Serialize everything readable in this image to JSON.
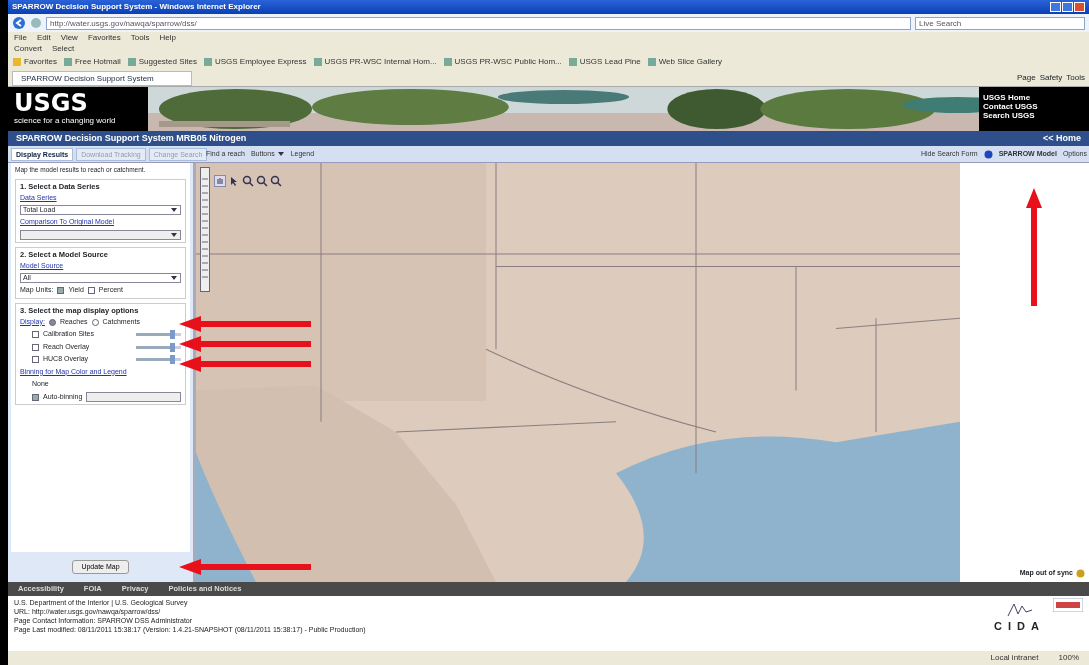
{
  "browser": {
    "title": "SPARROW Decision Support System - Windows Internet Explorer",
    "address": "http://water.usgs.gov/nawqa/sparrow/dss/",
    "search": "Live Search",
    "menu": [
      "File",
      "Edit",
      "View",
      "Favorites",
      "Tools",
      "Help"
    ],
    "toolbar": [
      "Convert",
      "Select"
    ],
    "favorites": [
      "Favorites",
      "Free Hotmail",
      "Suggested Sites",
      "USGS Employee Express",
      "USGS PR-WSC Internal Hom...",
      "USGS PR-WSC Public Hom...",
      "USGS Lead Pine",
      "Web Slice Gallery"
    ],
    "tab": "SPARROW Decision Support System",
    "commands": [
      "Page",
      "Safety",
      "Tools"
    ]
  },
  "banner": {
    "logo": "USGS",
    "tagline": "science for a changing world",
    "links": [
      "USGS Home",
      "Contact USGS",
      "Search USGS"
    ]
  },
  "app_title": "SPARROW Decision Support System MRB05 Nitrogen",
  "home_link": "<< Home",
  "tabs": [
    {
      "label": "Display Results",
      "selected": true
    },
    {
      "label": "Download Tracking",
      "selected": false
    },
    {
      "label": "Change Search",
      "selected": false
    }
  ],
  "map_toolbar": {
    "find": "Find a reach",
    "buttons": "Buttons",
    "legend": "Legend",
    "hide": "Hide Search Form",
    "model": "SPARROW Model",
    "options": "Options"
  },
  "hint": "Map the model results to reach or catchment.",
  "sections": [
    {
      "title": "1. Select a Data Series",
      "rows": [
        {
          "kind": "link",
          "text": "Data Series"
        },
        {
          "kind": "select",
          "text": "Total Load",
          "disabled": false
        },
        {
          "kind": "link",
          "text": "Comparison To Original Model"
        },
        {
          "kind": "select",
          "text": "",
          "disabled": true
        }
      ]
    },
    {
      "title": "2. Select a Model Source",
      "rows": [
        {
          "kind": "link",
          "text": "Model Source"
        },
        {
          "kind": "select",
          "text": "All",
          "disabled": false
        },
        {
          "kind": "units",
          "text": "Map Units:",
          "options": [
            {
              "label": "Yield",
              "checked": true
            },
            {
              "label": "Percent",
              "checked": false
            }
          ]
        }
      ]
    },
    {
      "title": "3. Select the map display options",
      "rows": [
        {
          "kind": "display",
          "text": "Display:",
          "options": [
            {
              "label": "Reaches",
              "selected": true
            },
            {
              "label": "Catchments",
              "selected": false
            }
          ]
        },
        {
          "kind": "overlay",
          "text": "Calibration Sites",
          "checked": false,
          "level": 0.8
        },
        {
          "kind": "overlay",
          "text": "Reach Overlay",
          "checked": false,
          "level": 0.8
        },
        {
          "kind": "overlay",
          "text": "HUC8 Overlay",
          "checked": false,
          "level": 0.8
        },
        {
          "kind": "link",
          "text": "Binning for Map Color and Legend"
        },
        {
          "kind": "plain",
          "text": "None"
        },
        {
          "kind": "auto",
          "text": "Auto-binning",
          "checked": true
        }
      ]
    }
  ],
  "update_button": "Update Map",
  "sync_status": "Map out of sync",
  "footer": {
    "links": [
      "Accessibility",
      "FOIA",
      "Privacy",
      "Policies and Notices"
    ],
    "lines": [
      "U.S. Department of the Interior | U.S. Geological Survey",
      "URL: http://water.usgs.gov/nawqa/sparrow/dss/",
      "Page Contact Information: SPARROW DSS Administrator",
      "Page Last modified: 08/11/2011 15:38:17 (Version: 1.4.21-SNAPSHOT (08/11/2011 15:38:17) - Public Production)"
    ],
    "cida": "CIDA"
  },
  "status_bar": {
    "zone": "Local intranet",
    "zoom": "100%"
  }
}
